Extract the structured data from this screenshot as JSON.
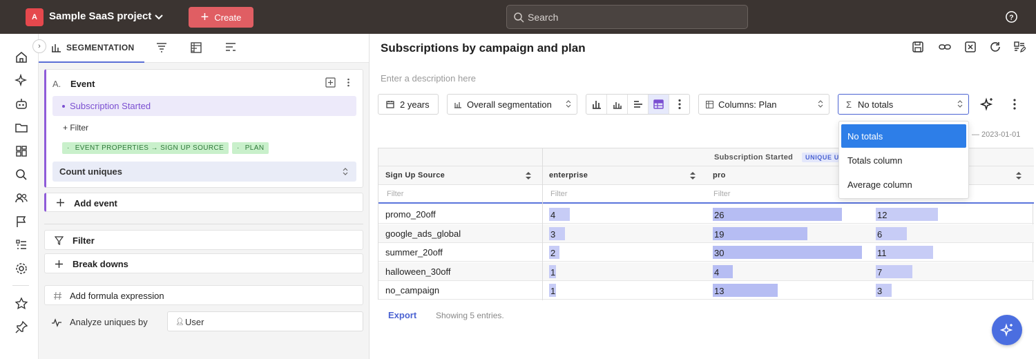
{
  "topbar": {
    "project_initial": "A",
    "project_name": "Sample SaaS project",
    "create_label": "Create",
    "search_placeholder": "Search"
  },
  "left_panel": {
    "active_tab": "SEGMENTATION",
    "event": {
      "letter": "A.",
      "title": "Event",
      "selected_event": "Subscription Started",
      "filter_label": "+ Filter",
      "chips": [
        "EVENT PROPERTIES → SIGN UP SOURCE",
        "PLAN"
      ],
      "measure": "Count uniques"
    },
    "add_event_label": "Add event",
    "filter_label": "Filter",
    "breakdowns_label": "Break downs",
    "formula_label": "Add formula expression",
    "analyze_label": "Analyze uniques by",
    "analyze_value": "User"
  },
  "main": {
    "title": "Subscriptions by campaign and plan",
    "description_placeholder": "Enter a description here",
    "controls": {
      "date_range": "2 years",
      "segmentation": "Overall segmentation",
      "columns": "Columns: Plan",
      "totals": "No totals"
    },
    "totals_options": [
      "No totals",
      "Totals column",
      "Average column"
    ],
    "totals_selected_index": 0,
    "date_label": "— 2023-01-01",
    "table": {
      "group_header": "Subscription Started",
      "group_badge": "UNIQUE U",
      "row_header": "Sign Up Source",
      "columns": [
        "enterprise",
        "pro",
        ""
      ],
      "filter_placeholder": "Filter",
      "rows": [
        {
          "source": "promo_20off",
          "values": [
            4,
            26,
            12
          ]
        },
        {
          "source": "google_ads_global",
          "values": [
            3,
            19,
            6
          ]
        },
        {
          "source": "summer_20off",
          "values": [
            2,
            30,
            11
          ]
        },
        {
          "source": "halloween_30off",
          "values": [
            1,
            4,
            7
          ]
        },
        {
          "source": "no_campaign",
          "values": [
            1,
            13,
            3
          ]
        }
      ]
    },
    "export_label": "Export",
    "showing_text": "Showing 5 entries."
  },
  "colors": {
    "accent": "#4b63d2",
    "event_color": "#8f5bd8",
    "create_button": "#e05e63",
    "bar": "#c7ccf6"
  }
}
